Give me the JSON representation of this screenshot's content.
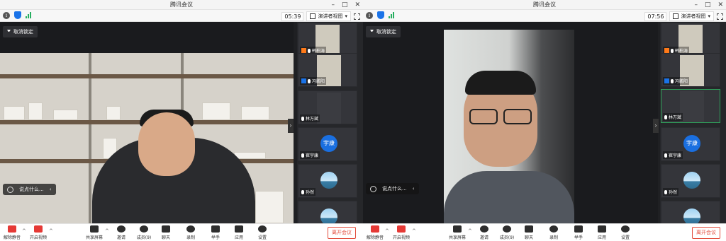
{
  "window": {
    "title": "腾讯会议"
  },
  "left": {
    "clock": "05:39",
    "view_mode": "演讲者视图",
    "pin_label": "取消锁定",
    "chat_placeholder": "说点什么...",
    "participants": [
      {
        "name": "韩柏涛",
        "badge": "orange",
        "type": "video",
        "active": false
      },
      {
        "name": "冯鹏阳",
        "badge": "blue",
        "type": "video",
        "active": false
      },
      {
        "name": "林万斌",
        "badge": "none",
        "type": "video",
        "active": false
      },
      {
        "name": "崔宇康",
        "badge": "none",
        "type": "avatar",
        "avatar_text": "宇康",
        "active": false
      },
      {
        "name": "孙然",
        "badge": "none",
        "type": "image",
        "active": false
      }
    ]
  },
  "right": {
    "clock": "07:56",
    "view_mode": "演讲者视图",
    "pin_label": "取消锁定",
    "chat_placeholder": "说点什么...",
    "participants": [
      {
        "name": "韩柏涛",
        "badge": "orange",
        "type": "video",
        "active": false
      },
      {
        "name": "冯鹏阳",
        "badge": "blue",
        "type": "video",
        "active": false
      },
      {
        "name": "林万斌",
        "badge": "none",
        "type": "video",
        "active": true
      },
      {
        "name": "崔宇康",
        "badge": "none",
        "type": "avatar",
        "avatar_text": "宇康",
        "active": false
      },
      {
        "name": "孙然",
        "badge": "none",
        "type": "image",
        "active": false
      }
    ]
  },
  "toolbar": {
    "unmute": "解除静音",
    "start_video": "开启视频",
    "share_screen": "共享屏幕",
    "invite": "邀请",
    "members": "成员(9)",
    "chat": "聊天",
    "record": "录制",
    "raise_hand": "举手",
    "apps": "应用",
    "settings": "设置",
    "leave": "离开会议"
  },
  "colors": {
    "accent_blue": "#1a73e8",
    "leave_red": "#e24b3b",
    "active_green": "#2fa05a",
    "badge_orange": "#ff7a19"
  }
}
